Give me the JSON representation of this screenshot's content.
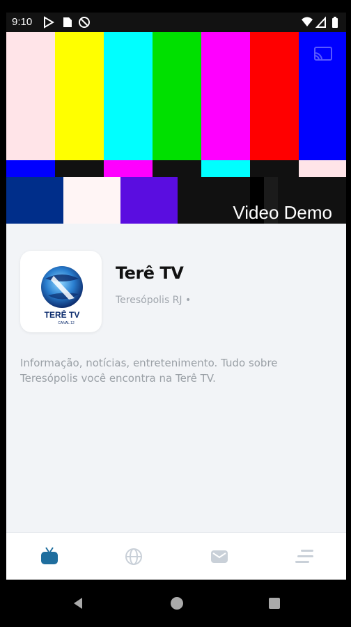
{
  "status_bar": {
    "time": "9:10",
    "left_icons": [
      "play-store-icon",
      "sd-card-icon",
      "blocked-icon"
    ],
    "right_icons": [
      "wifi-icon",
      "signal-icon",
      "battery-icon"
    ]
  },
  "video": {
    "title": "Video Demo",
    "cast_icon": "cast-icon"
  },
  "app": {
    "name": "Terê TV",
    "location": "Teresópolis RJ •",
    "description": "Informação, notícias, entretenimento. Tudo sobre Teresópolis você encontra na Terê TV.",
    "logo_text": "TERÊ TV",
    "logo_subtext": "CANAL 12"
  },
  "tabs": [
    {
      "name": "tv-icon",
      "active": true
    },
    {
      "name": "globe-icon",
      "active": false
    },
    {
      "name": "mail-icon",
      "active": false
    },
    {
      "name": "menu-icon",
      "active": false
    }
  ],
  "colors": {
    "accent": "#1f6e9e",
    "inactive": "#c9d0d8",
    "background": "#f2f4f7"
  }
}
